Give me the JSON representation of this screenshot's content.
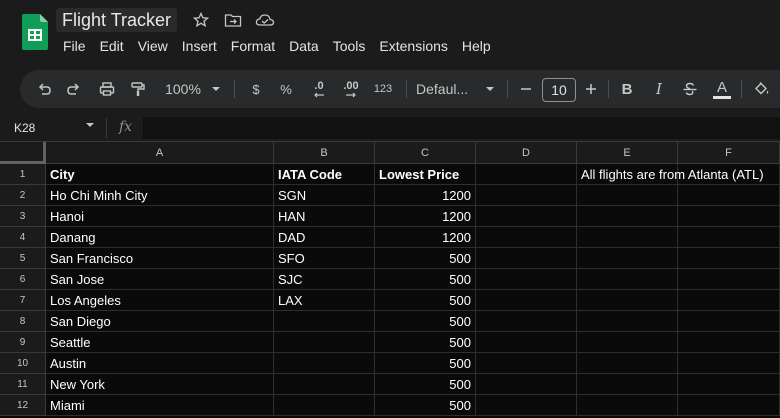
{
  "app": {
    "doc_title": "Flight Tracker",
    "icons": [
      "sheets-logo",
      "star-icon",
      "move-to-folder-icon",
      "cloud-saved-icon"
    ]
  },
  "menu": [
    "File",
    "Edit",
    "View",
    "Insert",
    "Format",
    "Data",
    "Tools",
    "Extensions",
    "Help"
  ],
  "toolbar": {
    "zoom": "100%",
    "currency": "$",
    "percent": "%",
    "decrease_decimal": ".0",
    "increase_decimal": ".00",
    "more_formats": "123",
    "font": "Defaul...",
    "font_size": "10",
    "bold": "B",
    "italic": "I",
    "text_color_letter": "A"
  },
  "formula_bar": {
    "cell_ref": "K28",
    "fx": "fx",
    "value": ""
  },
  "columns": [
    "A",
    "B",
    "C",
    "D",
    "E",
    "F"
  ],
  "rows": [
    {
      "num": "1",
      "cells": [
        "City",
        "IATA Code",
        "Lowest Price",
        "",
        "All flights are from Atlanta (ATL)",
        ""
      ]
    },
    {
      "num": "2",
      "cells": [
        "Ho Chi Minh City",
        "SGN",
        "1200",
        "",
        "",
        ""
      ]
    },
    {
      "num": "3",
      "cells": [
        "Hanoi",
        "HAN",
        "1200",
        "",
        "",
        ""
      ]
    },
    {
      "num": "4",
      "cells": [
        "Danang",
        "DAD",
        "1200",
        "",
        "",
        ""
      ]
    },
    {
      "num": "5",
      "cells": [
        "San Francisco",
        "SFO",
        "500",
        "",
        "",
        ""
      ]
    },
    {
      "num": "6",
      "cells": [
        "San Jose",
        "SJC",
        "500",
        "",
        "",
        ""
      ]
    },
    {
      "num": "7",
      "cells": [
        "Los Angeles",
        "LAX",
        "500",
        "",
        "",
        ""
      ]
    },
    {
      "num": "8",
      "cells": [
        "San Diego",
        "",
        "500",
        "",
        "",
        ""
      ]
    },
    {
      "num": "9",
      "cells": [
        "Seattle",
        "",
        "500",
        "",
        "",
        ""
      ]
    },
    {
      "num": "10",
      "cells": [
        "Austin",
        "",
        "500",
        "",
        "",
        ""
      ]
    },
    {
      "num": "11",
      "cells": [
        "New York",
        "",
        "500",
        "",
        "",
        ""
      ]
    },
    {
      "num": "12",
      "cells": [
        "Miami",
        "",
        "500",
        "",
        "",
        ""
      ]
    }
  ],
  "colors": {
    "sheets_green": "#0f9d58",
    "background": "#0a0a0a",
    "chrome": "#1b1b1b"
  }
}
